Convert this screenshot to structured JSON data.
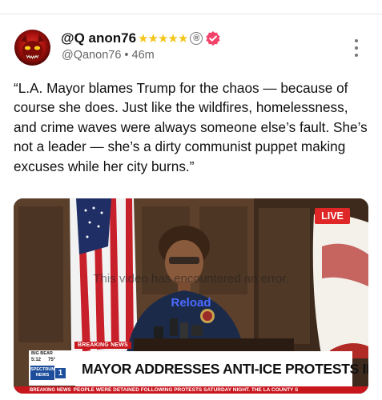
{
  "post": {
    "author_name": "@Q anon76",
    "stars": "★★★★★",
    "registered_mark": "®",
    "handle": "@Qanon76",
    "separator": "•",
    "time_ago": "46m",
    "text": "“L.A. Mayor blames Trump for the chaos — because of course she does. Just like the wildfires, homelessness, and crime waves were always someone else’s fault. She’s not a leader — she’s a dirty communist puppet making excuses while her city burns.”"
  },
  "video": {
    "live_badge": "LIVE",
    "error_message": "This video has encountered an error.",
    "reload_label": "Reload",
    "breaking_news_tag": "BREAKING NEWS",
    "station_city": "BIG BEAR",
    "station_time": "5:12",
    "station_temp": "75°",
    "station_logo": "SPECTRUM NEWS",
    "station_channel": "1",
    "headline": "MAYOR ADDRESSES ANTI-ICE PROTESTS IN DTLA",
    "crawl_label": "BREAKING NEWS",
    "crawl_text": "PEOPLE WERE DETAINED FOLLOWING PROTESTS SATURDAY NIGHT. THE LA COUNTY S"
  },
  "icons": {
    "verified": "verified-badge-icon",
    "more": "more-options-icon"
  },
  "colors": {
    "verified_badge": "#f2426a",
    "stars": "#f5c518",
    "live_badge": "#e02727",
    "news_red": "#c8161d",
    "reload_link": "#4a6cff"
  }
}
